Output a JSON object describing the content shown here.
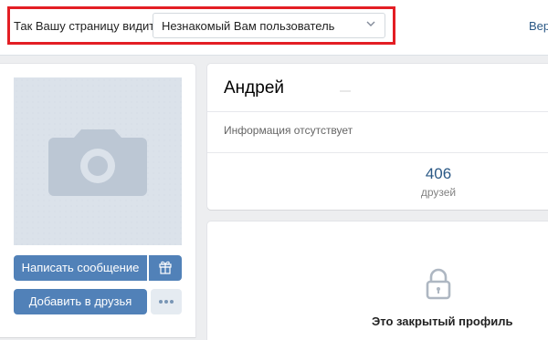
{
  "viewer_switch": {
    "label": "Так Вашу страницу видит",
    "selected": "Незнакомый Вам пользователь",
    "return_link": "Вер"
  },
  "profile": {
    "name": "Андрей",
    "info": "Информация отсутствует",
    "friends_count": "406",
    "friends_label": "друзей",
    "closed_title": "Это закрытый профиль"
  },
  "actions": {
    "write_message": "Написать сообщение",
    "add_friend": "Добавить в друзья"
  },
  "icons": {
    "avatar": "camera-icon",
    "gift": "gift-icon",
    "more": "more-dots-icon",
    "chevron": "chevron-down-icon",
    "lock": "lock-icon"
  },
  "colors": {
    "highlight_frame": "#e31e24",
    "button": "#5181b8",
    "link": "#2a5885"
  }
}
